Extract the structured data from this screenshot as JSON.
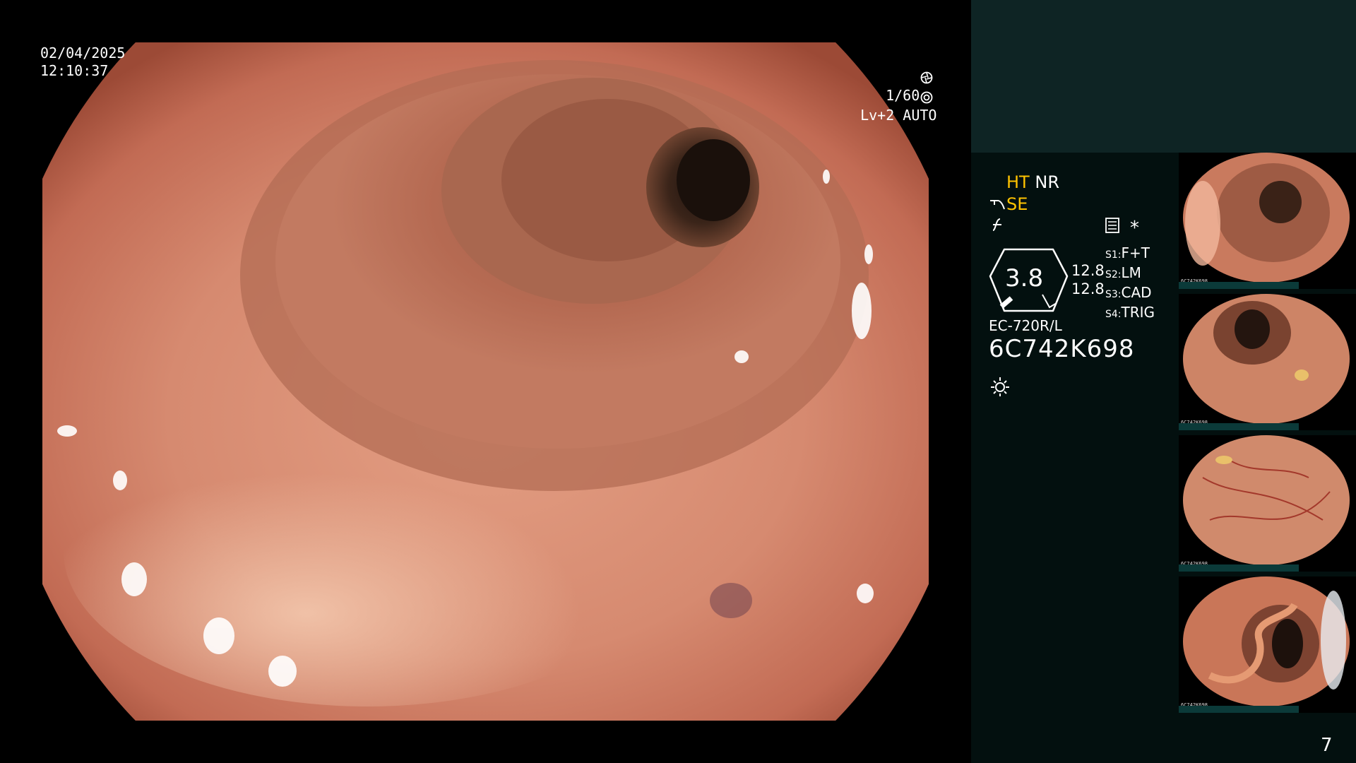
{
  "overlay": {
    "date": "02/04/2025",
    "time": "12:10:37",
    "shutter": "1/60",
    "level": "Lv+2 AUTO"
  },
  "panel": {
    "mode_ht": "HT",
    "mode_nr": "NR",
    "mode_se": "SE",
    "gauge_value": "3.8",
    "gauge_side_1": "12.8",
    "gauge_side_2": "12.8",
    "presets": [
      {
        "key": "S1:",
        "value": "F+T"
      },
      {
        "key": "S2:",
        "value": "LM"
      },
      {
        "key": "S3:",
        "value": "CAD"
      },
      {
        "key": "S4:",
        "value": "TRIG"
      }
    ],
    "scope_model": "EC-720R/L",
    "scope_serial": "6C742K698",
    "asterisk": "*"
  },
  "thumbnails": [
    {
      "serial": "6C742K698"
    },
    {
      "serial": "6C742K698"
    },
    {
      "serial": "6C742K698"
    },
    {
      "serial": "6C742K698"
    }
  ],
  "page_number": "7",
  "colors": {
    "mode_accent": "#ffc300",
    "panel_top": "#0e2424",
    "panel_bottom": "#03100f"
  },
  "icons": [
    "shutter-icon",
    "auto-iris-icon",
    "pen-icon",
    "flash-icon",
    "settings-list-icon",
    "sun-icon"
  ]
}
